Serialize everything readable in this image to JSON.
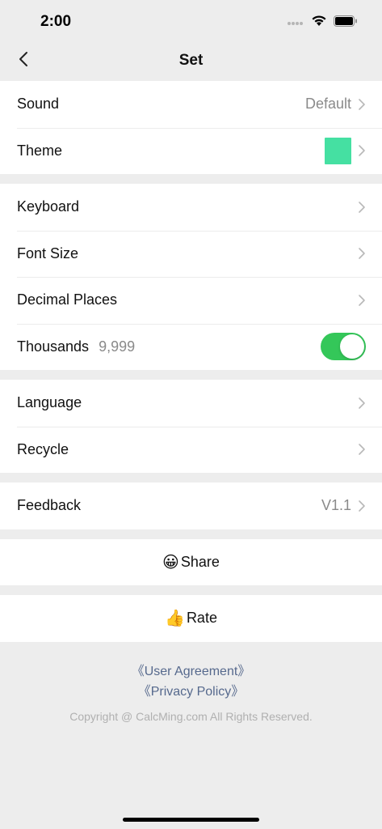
{
  "status_bar": {
    "time": "2:00",
    "icons": [
      "signal-dots-icon",
      "wifi-icon",
      "battery-icon"
    ]
  },
  "nav": {
    "title": "Set",
    "back_icon": "chevron-left-icon"
  },
  "groups": {
    "group1": {
      "sound": {
        "label": "Sound",
        "value": "Default"
      },
      "theme": {
        "label": "Theme",
        "swatch_color": "#45e0a2"
      }
    },
    "group2": {
      "keyboard": {
        "label": "Keyboard"
      },
      "font_size": {
        "label": "Font Size"
      },
      "decimal_places": {
        "label": "Decimal Places"
      },
      "thousands": {
        "label": "Thousands",
        "example": "9,999",
        "enabled": true
      }
    },
    "group3": {
      "language": {
        "label": "Language"
      },
      "recycle": {
        "label": "Recycle"
      }
    },
    "group4": {
      "feedback": {
        "label": "Feedback",
        "value": "V1.1"
      }
    }
  },
  "actions": {
    "share": {
      "emoji": "😀",
      "label": "Share"
    },
    "rate": {
      "emoji": "👍",
      "label": "Rate"
    }
  },
  "footer": {
    "user_agreement": "《User Agreement》",
    "privacy_policy": "《Privacy Policy》",
    "copyright": "Copyright @ CalcMing.com All Rights Reserved."
  },
  "colors": {
    "accent_toggle": "#34c759",
    "link": "#56698d",
    "background": "#ededed"
  }
}
